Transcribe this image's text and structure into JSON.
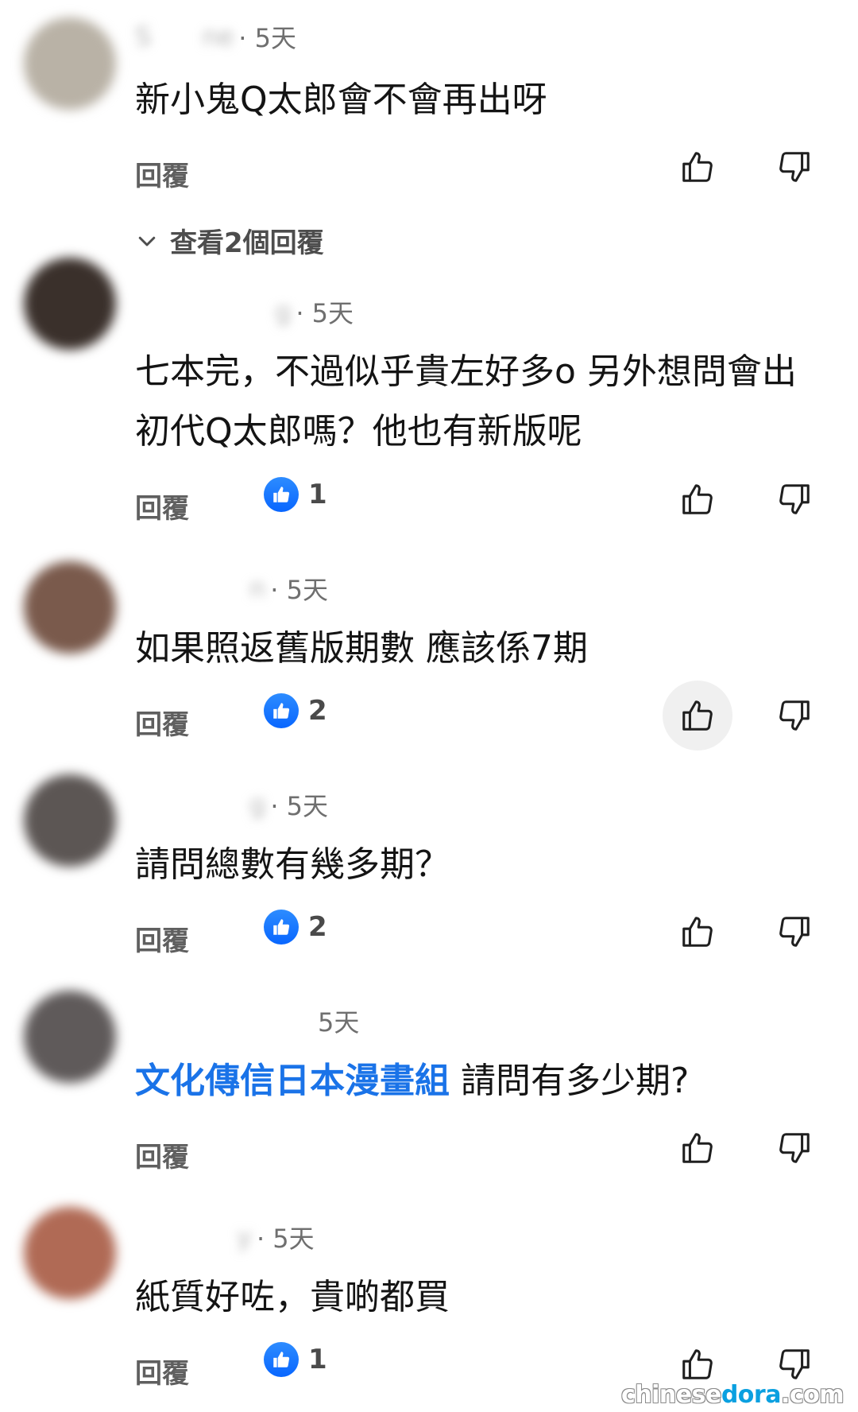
{
  "comments": [
    {
      "author": "S    ne",
      "time": "· 5天",
      "text": "新小鬼Q太郎會不會再出呀",
      "reply_label": "回覆",
      "likes": "",
      "view_replies": "查看2個回覆",
      "avatar_color": "#b9b2a6"
    },
    {
      "author": "           g",
      "time": "· 5天",
      "text": "七本完，不過似乎貴左好多o 另外想問會出初代Q太郎嗎？他也有新版呢",
      "reply_label": "回覆",
      "likes": "1",
      "avatar_color": "#3a302b"
    },
    {
      "author": "         n",
      "time": "· 5天",
      "text": "如果照返舊版期數 應該係7期",
      "reply_label": "回覆",
      "likes": "2",
      "avatar_color": "#7a5a4c"
    },
    {
      "author": "         g",
      "time": "· 5天",
      "text": "請問總數有幾多期？",
      "reply_label": "回覆",
      "likes": "2",
      "avatar_color": "#5c5654"
    },
    {
      "author": "              ",
      "time": "5天",
      "mention": "文化傳信日本漫畫組",
      "text": "請問有多少期?",
      "reply_label": "回覆",
      "likes": "",
      "avatar_color": "#5f5a5a"
    },
    {
      "author": "        y",
      "time": "· 5天",
      "text": "紙質好咗，貴啲都買",
      "reply_label": "回覆",
      "likes": "1",
      "avatar_color": "#b06a55"
    }
  ],
  "watermark": {
    "part1": "chinese",
    "part2": "dora",
    "part3": ".com"
  },
  "colors": {
    "accent": "#1a73e8",
    "reaction_blue": "#0866ff"
  },
  "icons": {
    "like": "thumbs-up-outline",
    "dislike": "thumbs-down-outline",
    "reaction": "thumbs-up-badge",
    "expand": "chevron-down"
  }
}
